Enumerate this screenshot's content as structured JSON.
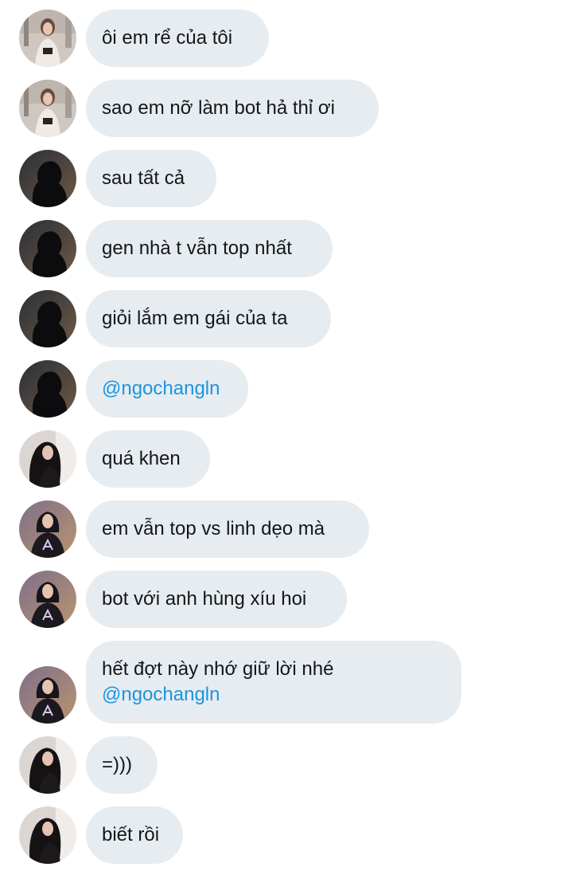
{
  "colors": {
    "bubble_bg": "#e6ecf0",
    "text": "#14171a",
    "mention": "#1b95e0"
  },
  "messages": [
    {
      "avatar": "white-sweater-woman-avatar",
      "text": "ôi em rể của tôi",
      "mention": ""
    },
    {
      "avatar": "white-sweater-woman-avatar",
      "text": "sao em nỡ làm bot hả thỉ ơi",
      "mention": ""
    },
    {
      "avatar": "silhouette-avatar",
      "text": "sau tất cả",
      "mention": ""
    },
    {
      "avatar": "silhouette-avatar",
      "text": "gen nhà t vẫn top nhất",
      "mention": ""
    },
    {
      "avatar": "silhouette-avatar",
      "text": "giỏi lắm em gái của ta",
      "mention": ""
    },
    {
      "avatar": "silhouette-avatar",
      "text": "",
      "mention": "@ngochangln"
    },
    {
      "avatar": "dark-hair-girl-avatar",
      "text": "quá khen",
      "mention": ""
    },
    {
      "avatar": "purple-jacket-girl-avatar",
      "text": "em vẫn top vs linh dẹo mà",
      "mention": ""
    },
    {
      "avatar": "purple-jacket-girl-avatar",
      "text": "bot với anh hùng xíu hoi",
      "mention": ""
    },
    {
      "avatar": "purple-jacket-girl-avatar",
      "text": "hết đợt này nhớ giữ lời nhé",
      "mention": "@ngochangln"
    },
    {
      "avatar": "dark-hair-girl-avatar",
      "text": "=)))",
      "mention": ""
    },
    {
      "avatar": "dark-hair-girl-avatar",
      "text": "biết rồi",
      "mention": ""
    }
  ]
}
